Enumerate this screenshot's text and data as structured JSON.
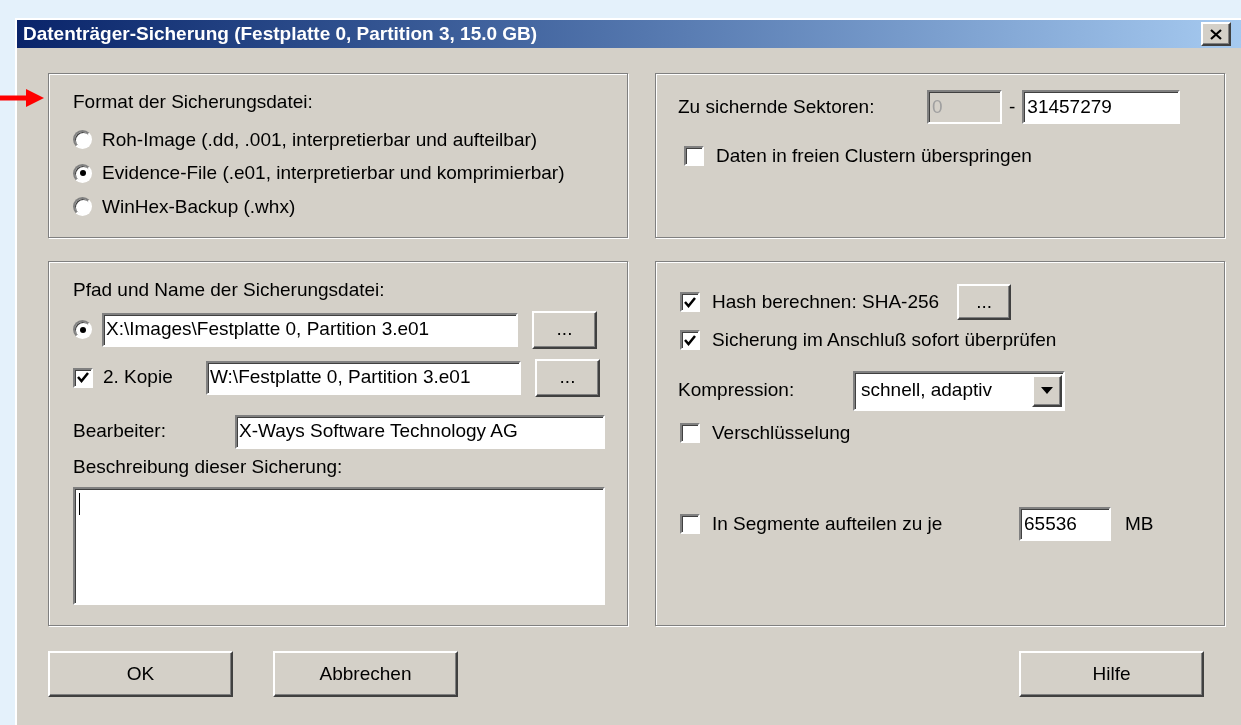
{
  "window": {
    "title": "Datenträger-Sicherung (Festplatte 0, Partition 3, 15.0 GB)"
  },
  "format_group": {
    "label": "Format der Sicherungsdatei:",
    "options": [
      {
        "label": "Roh-Image (.dd, .001, interpretierbar und aufteilbar)",
        "selected": false
      },
      {
        "label": "Evidence-File (.e01, interpretierbar und komprimierbar)",
        "selected": true
      },
      {
        "label": "WinHex-Backup (.whx)",
        "selected": false
      }
    ]
  },
  "sectors_group": {
    "label": "Zu sichernde Sektoren:",
    "from": {
      "value": "0",
      "disabled": true
    },
    "separator": "-",
    "to": {
      "value": "31457279",
      "disabled": false
    },
    "skip_free": {
      "label": "Daten in freien Clustern überspringen",
      "checked": false
    }
  },
  "path_group": {
    "label": "Pfad und Name der Sicherungsdatei:",
    "primary": {
      "selected": true,
      "value": "X:\\Images\\Festplatte 0, Partition 3.e01",
      "browse": "..."
    },
    "copy": {
      "label": "2. Kopie",
      "checked": true,
      "value": "W:\\Festplatte 0, Partition 3.e01",
      "browse": "..."
    },
    "editor": {
      "label": "Bearbeiter:",
      "value": "X-Ways Software Technology AG"
    },
    "description": {
      "label": "Beschreibung dieser Sicherung:"
    }
  },
  "options_group": {
    "hash": {
      "label": "Hash berechnen: SHA-256",
      "checked": true,
      "button": "..."
    },
    "verify": {
      "label": "Sicherung im Anschluß sofort überprüfen",
      "checked": true
    },
    "compression": {
      "label": "Kompression:",
      "value": "schnell, adaptiv"
    },
    "encryption": {
      "label": "Verschlüsselung",
      "checked": false
    },
    "segments": {
      "label": "In Segmente aufteilen zu je",
      "checked": false,
      "value": "65536",
      "unit": "MB"
    }
  },
  "buttons": [
    {
      "label": "OK",
      "kind": "left"
    },
    {
      "label": "Abbrechen",
      "kind": "left"
    },
    {
      "label": "Hilfe",
      "kind": "right"
    }
  ]
}
